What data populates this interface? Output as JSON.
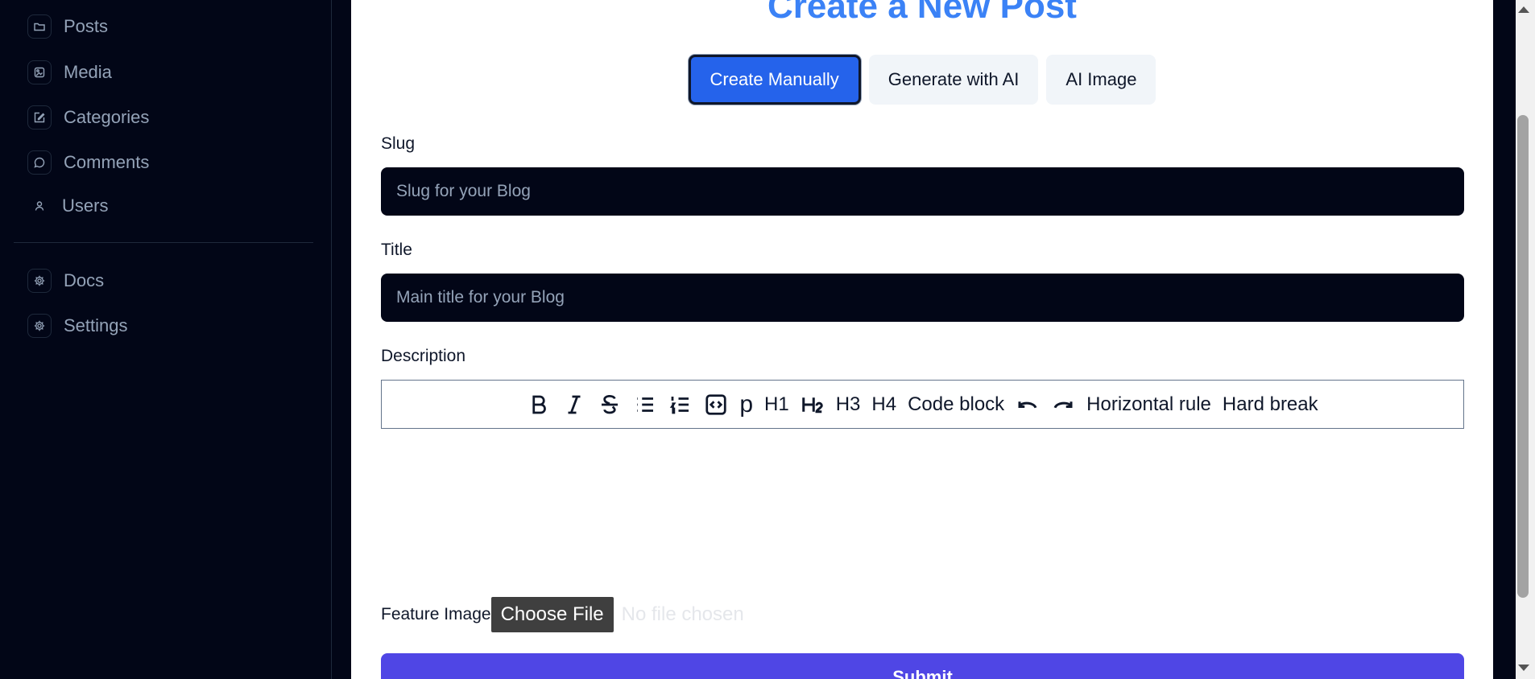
{
  "sidebar": {
    "items": [
      {
        "label": "Posts",
        "icon": "folder-icon"
      },
      {
        "label": "Media",
        "icon": "media-icon"
      },
      {
        "label": "Categories",
        "icon": "edit-icon"
      },
      {
        "label": "Comments",
        "icon": "comment-icon"
      },
      {
        "label": "Users",
        "icon": "user-icon"
      }
    ],
    "bottom_items": [
      {
        "label": "Docs",
        "icon": "gear-icon"
      },
      {
        "label": "Settings",
        "icon": "gear-icon"
      }
    ]
  },
  "main": {
    "title": "Create a New Post",
    "tabs": [
      {
        "label": "Create Manually",
        "active": true
      },
      {
        "label": "Generate with AI",
        "active": false
      },
      {
        "label": "AI Image",
        "active": false
      }
    ],
    "slug": {
      "label": "Slug",
      "placeholder": "Slug for your Blog"
    },
    "title_field": {
      "label": "Title",
      "placeholder": "Main title for your Blog"
    },
    "description": {
      "label": "Description",
      "toolbar": {
        "paragraph": "p",
        "h1": "H1",
        "h3": "H3",
        "h4": "H4",
        "code_block": "Code block",
        "horizontal_rule": "Horizontal rule",
        "hard_break": "Hard break"
      }
    },
    "feature_image": {
      "label": "Feature Image",
      "button": "Choose File",
      "status": "No file chosen"
    },
    "submit": "Submit"
  },
  "colors": {
    "accent": "#3b82f6",
    "primary_button": "#2563eb",
    "submit_button": "#4f46e5",
    "sidebar_bg": "#020617"
  }
}
